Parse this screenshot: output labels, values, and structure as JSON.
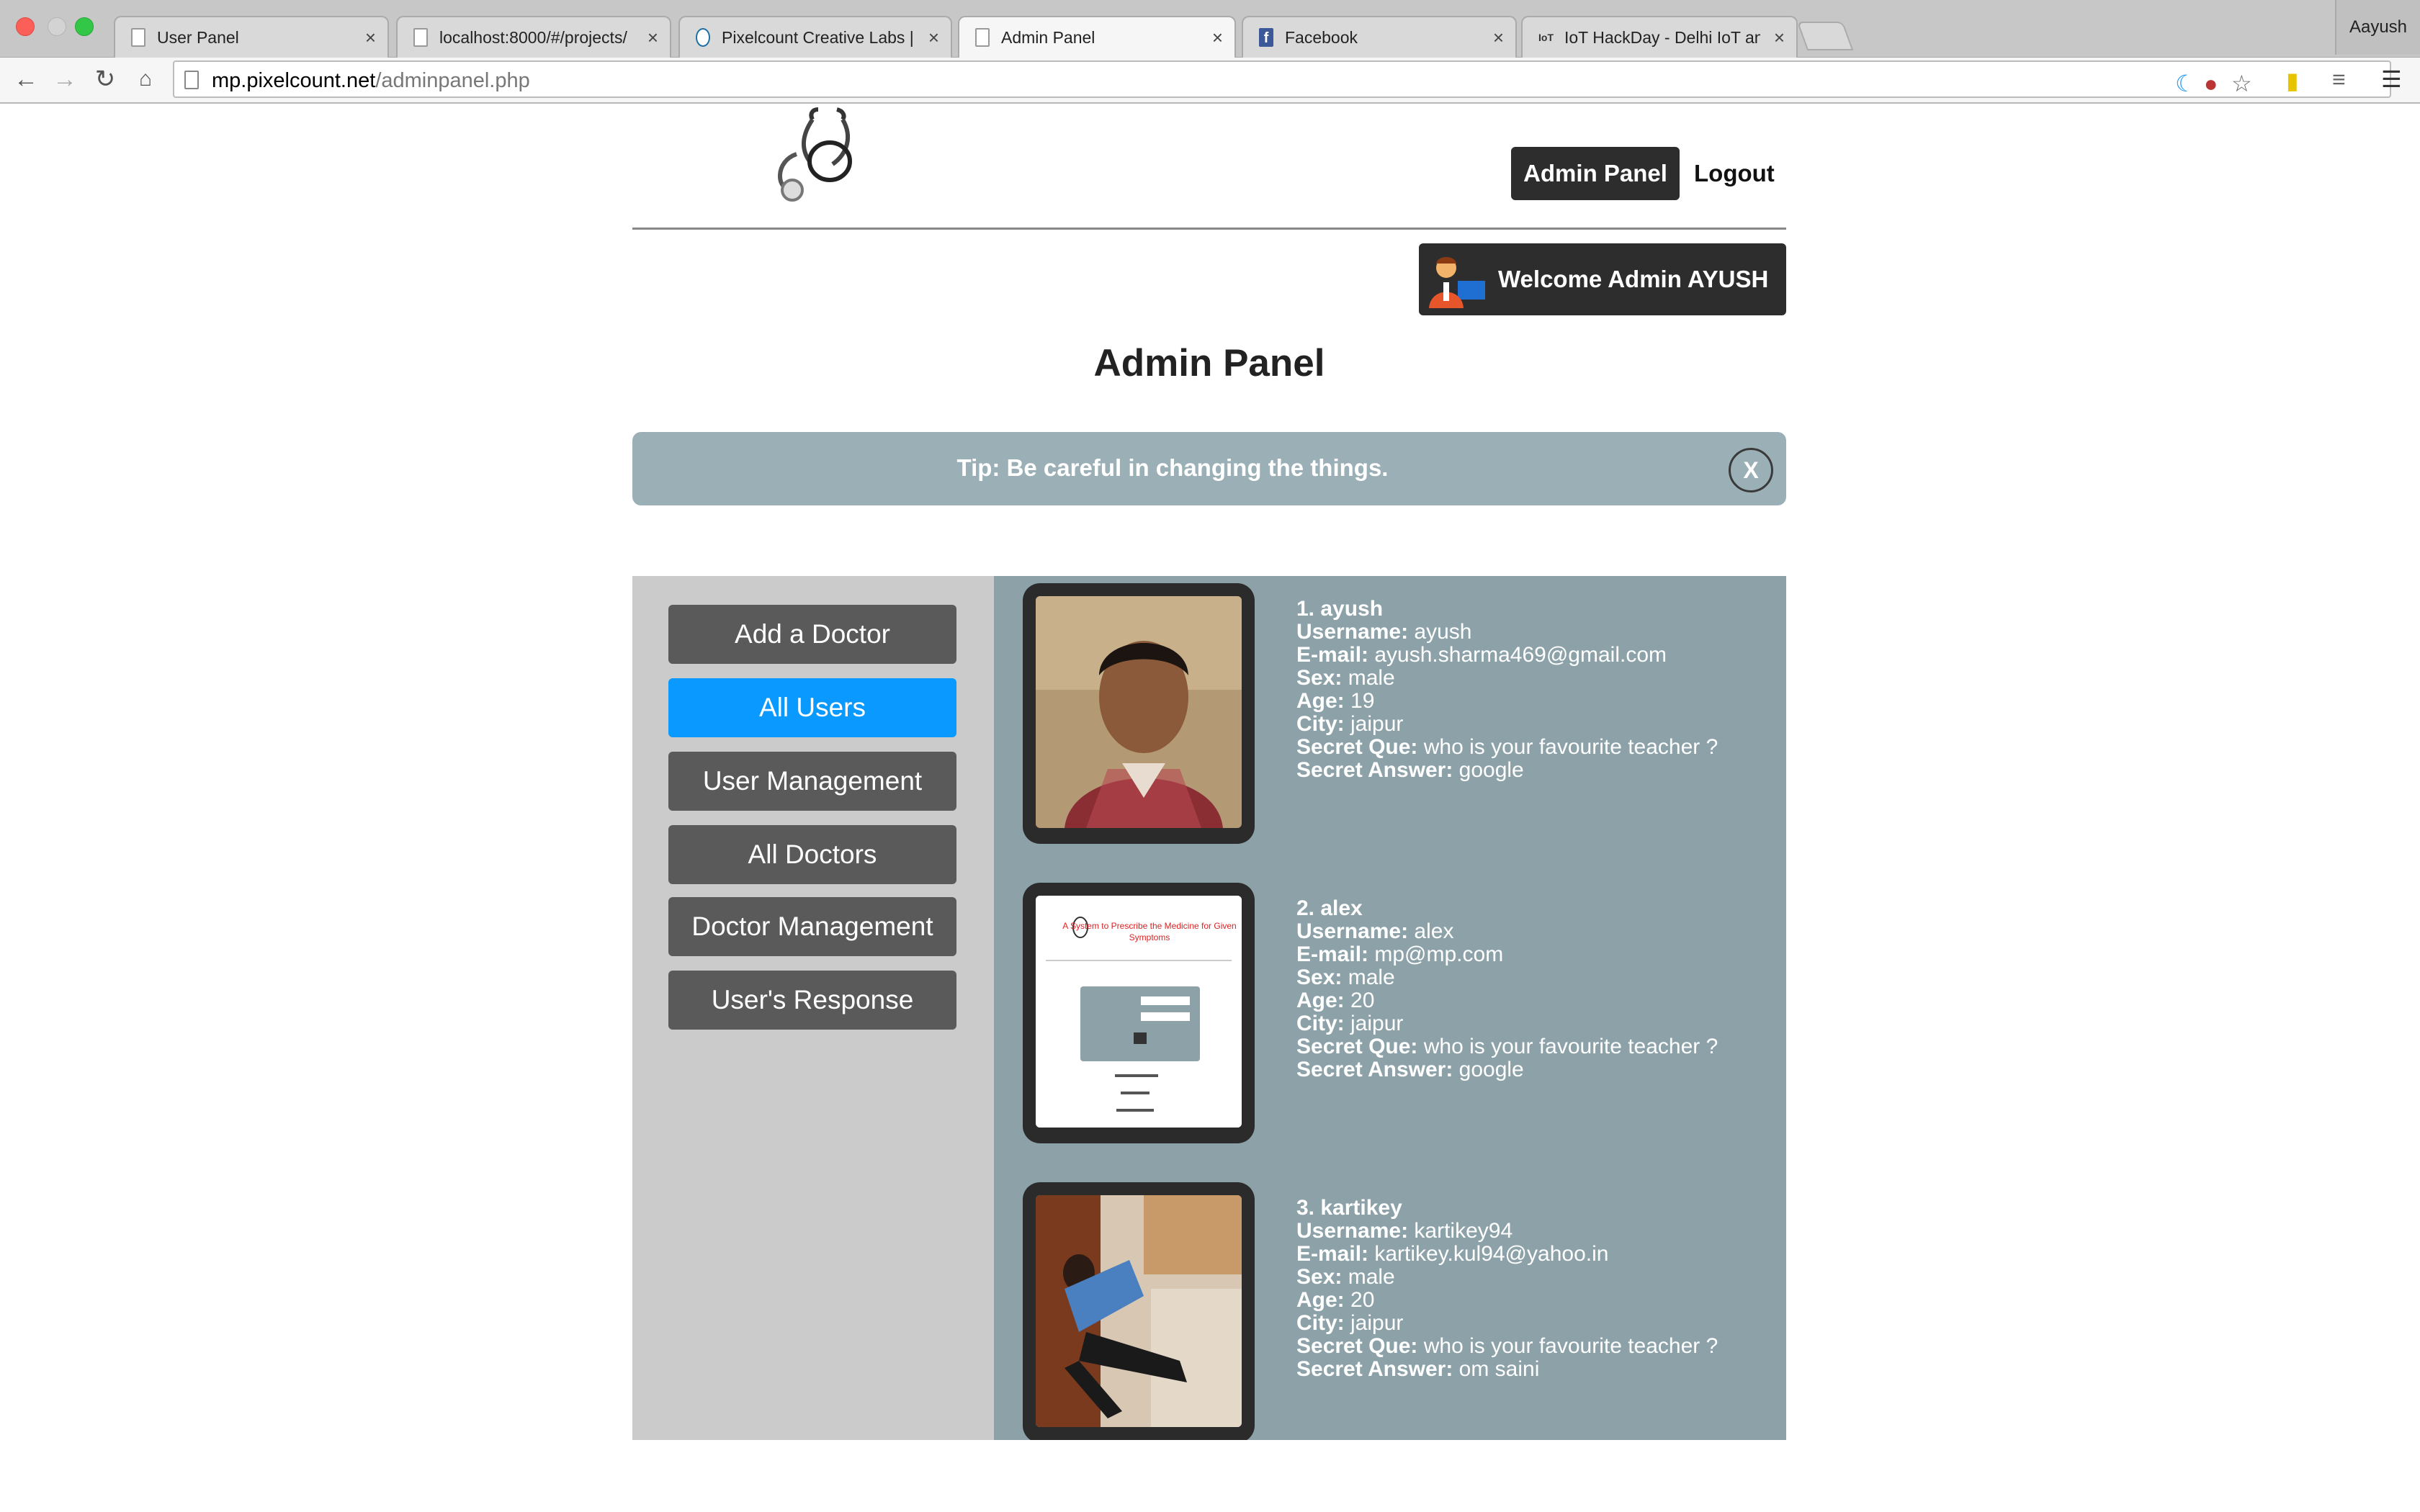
{
  "browser": {
    "tabs": [
      {
        "title": "User Panel",
        "icon": "page-icon"
      },
      {
        "title": "localhost:8000/#/projects/",
        "icon": "page-icon"
      },
      {
        "title": "Pixelcount Creative Labs | N",
        "icon": "pixelcount-icon"
      },
      {
        "title": "Admin Panel",
        "icon": "page-icon"
      },
      {
        "title": "Facebook",
        "icon": "facebook-icon"
      },
      {
        "title": "IoT HackDay - Delhi IoT and",
        "icon": "iot-icon"
      }
    ],
    "profile_name": "Aayush",
    "url_host": "mp.pixelcount.net",
    "url_path": "/adminpanel.php"
  },
  "header": {
    "admin_panel_label": "Admin Panel",
    "logout_label": "Logout",
    "welcome_text": "Welcome Admin AYUSH"
  },
  "page_title": "Admin Panel",
  "tip": {
    "text": "Tip: Be careful in changing the things.",
    "close_label": "X"
  },
  "sidebar": {
    "items": [
      {
        "label": "Add a Doctor",
        "active": false
      },
      {
        "label": "All Users",
        "active": true
      },
      {
        "label": "User Management",
        "active": false
      },
      {
        "label": "All Doctors",
        "active": false
      },
      {
        "label": "Doctor Management",
        "active": false
      },
      {
        "label": "User's Response",
        "active": false
      }
    ]
  },
  "field_labels": {
    "username": "Username:",
    "email": "E-mail:",
    "sex": "Sex:",
    "age": "Age:",
    "city": "City:",
    "secret_que": "Secret Que:",
    "secret_answer": "Secret Answer:"
  },
  "users": [
    {
      "heading": "1. ayush",
      "username": "ayush",
      "email": "ayush.sharma469@gmail.com",
      "sex": "male",
      "age": "19",
      "city": "jaipur",
      "secret_que": "who is your favourite teacher ?",
      "secret_answer": "google"
    },
    {
      "heading": "2. alex",
      "username": "alex",
      "email": "mp@mp.com",
      "sex": "male",
      "age": "20",
      "city": "jaipur",
      "secret_que": "who is your favourite teacher ?",
      "secret_answer": "google"
    },
    {
      "heading": "3. kartikey",
      "username": "kartikey94",
      "email": "kartikey.kul94@yahoo.in",
      "sex": "male",
      "age": "20",
      "city": "jaipur",
      "secret_que": "who is your favourite teacher ?",
      "secret_answer": "om saini"
    }
  ],
  "screenshot_thumb": {
    "title_line1": "A System to Prescribe the Medicine for Given",
    "title_line2": "Symptoms"
  }
}
